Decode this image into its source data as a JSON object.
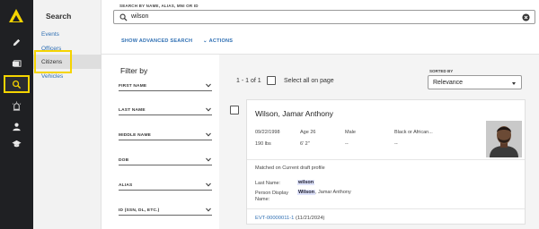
{
  "nav": {
    "title": "Search",
    "links": [
      "Events",
      "Officers",
      "Citizens",
      "Vehicles"
    ],
    "active": "Citizens"
  },
  "search": {
    "label": "SEARCH BY NAME, ALIAS, MNI OR ID",
    "value": "wilson",
    "advanced": "SHOW ADVANCED SEARCH",
    "actions": "ACTIONS"
  },
  "filter": {
    "title": "Filter by",
    "fields": [
      "FIRST NAME",
      "LAST NAME",
      "MIDDLE NAME",
      "DOB",
      "ALIAS",
      "ID (SSN, DL, ETC.)"
    ]
  },
  "results": {
    "count": "1 - 1 of 1",
    "select_all": "Select all on page",
    "sorted_label": "SORTED BY",
    "sort_value": "Relevance"
  },
  "card": {
    "name": "Wilson, Jamar Anthony",
    "dob": "09/22/1998",
    "age": "Age 26",
    "sex": "Male",
    "race": "Black or African...",
    "weight": "190 lbs",
    "height": "6' 2\"",
    "dash1": "--",
    "dash2": "--",
    "matched": "Matched on Current draft profile",
    "last_name_label": "Last Name:",
    "last_name_match": "wilson",
    "display_label_1": "Person Display",
    "display_label_2": "Name:",
    "display_match": "Wilson",
    "display_rest": ", Jamar Anthony",
    "event_id": "EVT-00000011-1",
    "event_date": "(11/21/2024)"
  },
  "colors": {
    "rail": "#1f2023",
    "accent": "#f5d400",
    "link": "#2f6fb3",
    "highlight": "#dfe3fb"
  }
}
